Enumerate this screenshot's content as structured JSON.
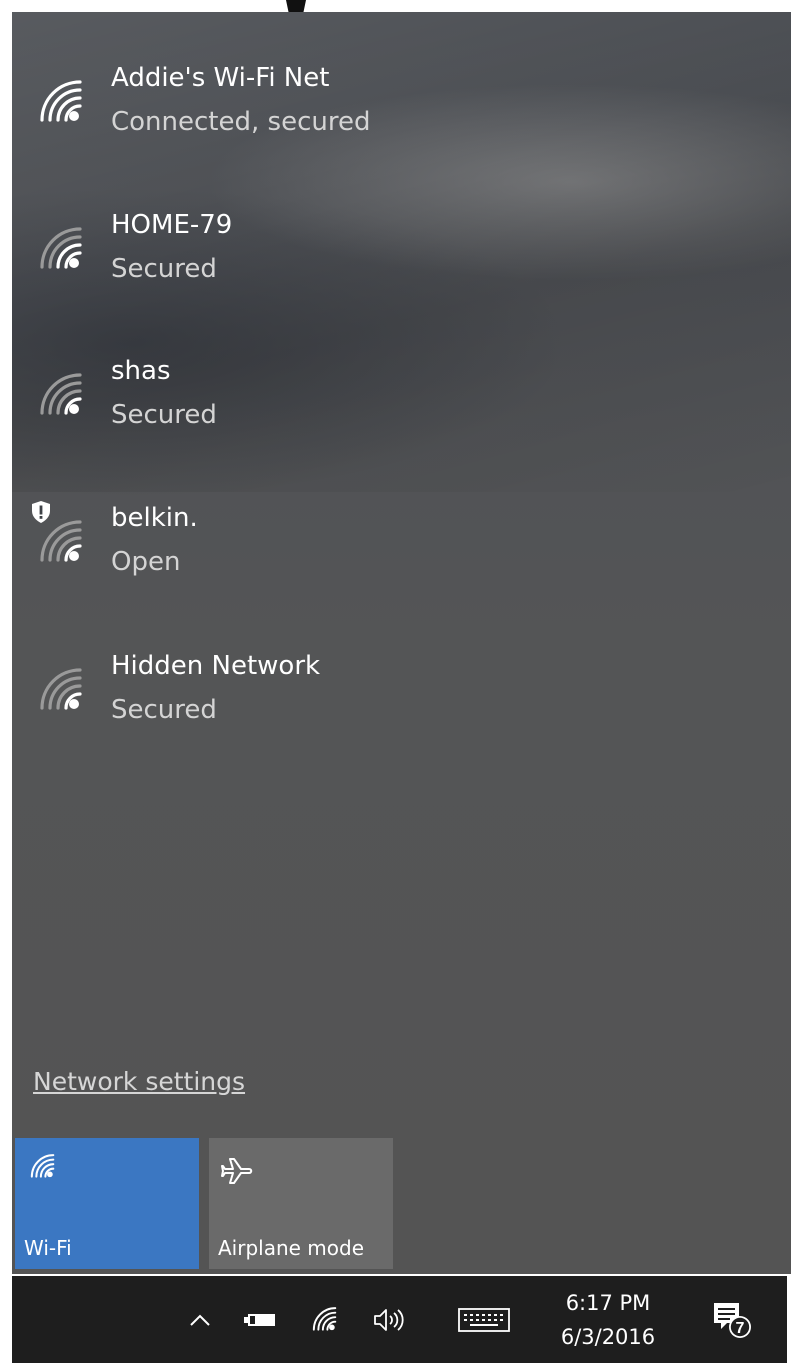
{
  "networks": [
    {
      "name": "Addie's Wi-Fi Net",
      "status": "Connected, secured",
      "icon": "wifi-signal-icon",
      "warning": false
    },
    {
      "name": "HOME-79",
      "status": "Secured",
      "icon": "wifi-signal-icon",
      "warning": false
    },
    {
      "name": "shas",
      "status": "Secured",
      "icon": "wifi-signal-icon",
      "warning": false
    },
    {
      "name": "belkin.",
      "status": "Open",
      "icon": "wifi-signal-icon",
      "warning": true
    },
    {
      "name": "Hidden Network",
      "status": "Secured",
      "icon": "wifi-signal-icon",
      "warning": false
    }
  ],
  "network_settings_label": "Network settings",
  "quick_actions": [
    {
      "label": "Wi-Fi",
      "icon": "wifi-icon",
      "active": true,
      "color": "#3b77c2"
    },
    {
      "label": "Airplane mode",
      "icon": "airplane-icon",
      "active": false,
      "color": "#6a6a6a"
    }
  ],
  "taskbar": {
    "tray_icons": [
      "chevron-up-icon",
      "battery-icon",
      "wifi-icon",
      "volume-icon",
      "keyboard-icon"
    ],
    "time": "6:17 PM",
    "date": "6/3/2016",
    "notification_count": "7"
  }
}
